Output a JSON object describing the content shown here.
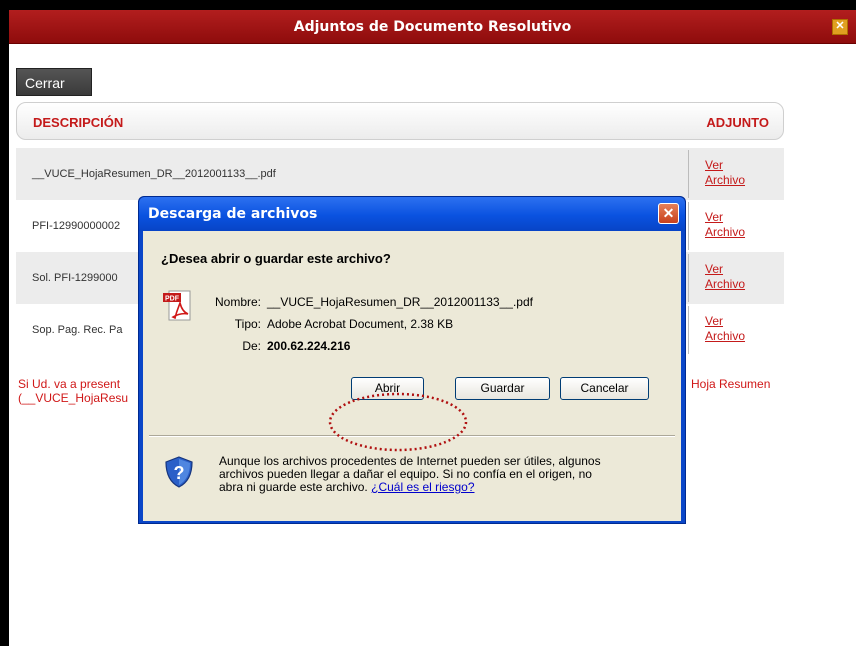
{
  "window": {
    "title": "Adjuntos de Documento Resolutivo",
    "close_glyph": "✕"
  },
  "toolbar": {
    "close_label": "Cerrar"
  },
  "grid": {
    "header_description": "DESCRIPCIÓN",
    "header_attachment": "ADJUNTO",
    "rows": [
      {
        "description": "__VUCE_HojaResumen_DR__2012001133__.pdf",
        "link_line1": "Ver",
        "link_line2": "Archivo"
      },
      {
        "description": "PFI-12990000002",
        "link_line1": "Ver",
        "link_line2": "Archivo"
      },
      {
        "description": "Sol. PFI-1299000",
        "link_line1": "Ver",
        "link_line2": "Archivo"
      },
      {
        "description": "Sop. Pag. Rec. Pa",
        "link_line1": "Ver",
        "link_line2": "Archivo"
      }
    ]
  },
  "note": {
    "line1_left": "Si Ud. va a present",
    "line2_left": "(__VUCE_HojaResu",
    "line1_right": "Hoja Resumen"
  },
  "dialog": {
    "title": "Descarga de archivos",
    "close_glyph": "✕",
    "question": "¿Desea abrir o guardar este archivo?",
    "name_label": "Nombre:",
    "name_value": "__VUCE_HojaResumen_DR__2012001133__.pdf",
    "type_label": "Tipo:",
    "type_value": "Adobe Acrobat Document, 2.38 KB",
    "from_label": "De:",
    "from_value": "200.62.224.216",
    "open_label": "Abrir",
    "save_label": "Guardar",
    "cancel_label": "Cancelar",
    "warning_text": "Aunque los archivos procedentes de Internet pueden ser útiles, algunos archivos pueden llegar a dañar el equipo. Si no confía en el origen, no abra ni guarde este archivo.",
    "risk_link": "¿Cuál es el riesgo?",
    "pdf_icon_text": "PDF",
    "shield_icon_text": "?"
  },
  "colors": {
    "brand_red": "#c41a1a",
    "dialog_blue": "#0a52e0",
    "annotation_red": "#b01010"
  }
}
